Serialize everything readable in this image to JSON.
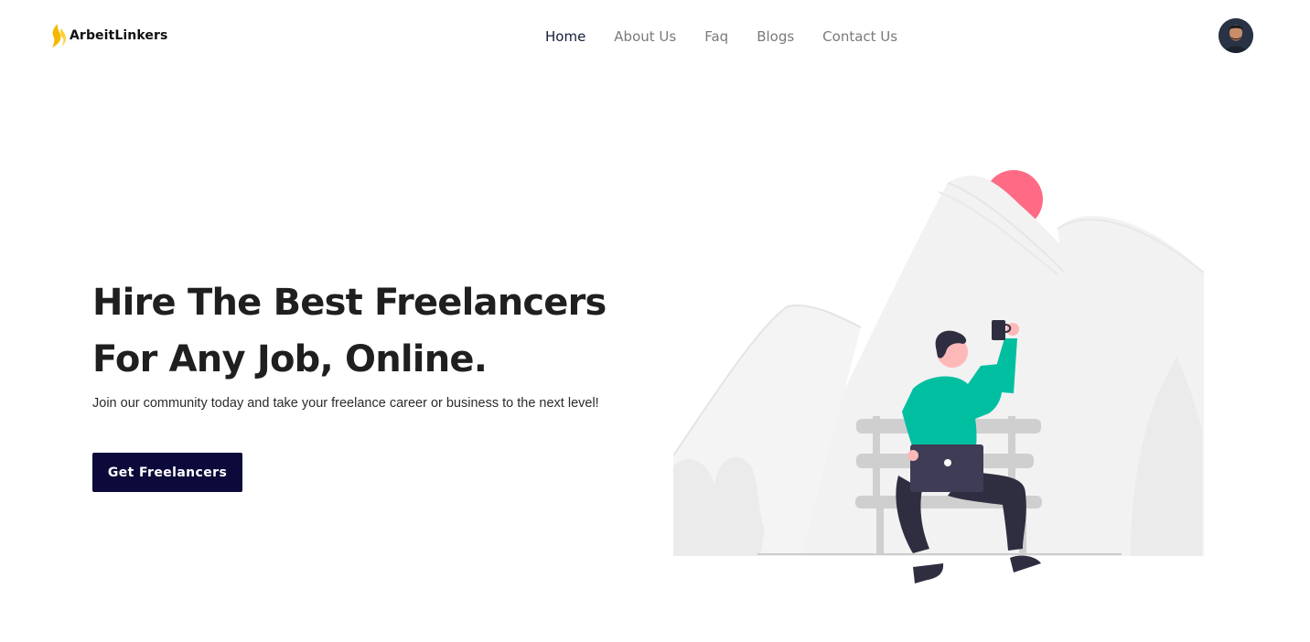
{
  "brand": {
    "name": "ArbeitLinkers",
    "logo_icon": "flame-logo-icon",
    "accent": "#f5b800"
  },
  "nav": {
    "items": [
      {
        "label": "Home",
        "active": true
      },
      {
        "label": "About Us",
        "active": false
      },
      {
        "label": "Faq",
        "active": false
      },
      {
        "label": "Blogs",
        "active": false
      },
      {
        "label": "Contact Us",
        "active": false
      }
    ]
  },
  "user": {
    "avatar_icon": "user-avatar"
  },
  "hero": {
    "title_line1": "Hire The Best Freelancers",
    "title_line2": "For Any Job, Online.",
    "subtitle": "Join our community today and take your freelance career or business to the next level!",
    "cta_label": "Get Freelancers"
  },
  "colors": {
    "cta_bg": "#0b0a3a",
    "sun": "#ff6b84",
    "shirt": "#00bfa0",
    "mountain_fill": "#f2f2f2"
  }
}
